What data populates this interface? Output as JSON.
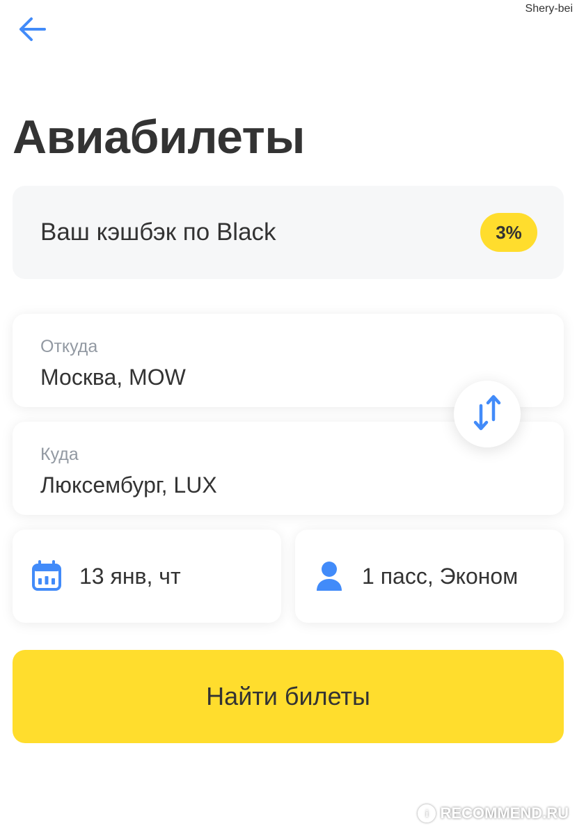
{
  "watermark_top": "Shery-bei",
  "header": {
    "back_icon": "arrow-left-icon",
    "title": "Авиабилеты"
  },
  "cashback": {
    "label": "Ваш кэшбэк по Black",
    "badge": "3%"
  },
  "from_field": {
    "label": "Откуда",
    "value": "Москва, MOW"
  },
  "to_field": {
    "label": "Куда",
    "value": "Люксембург, LUX"
  },
  "swap_icon": "swap-arrows-icon",
  "date_field": {
    "icon": "calendar-icon",
    "value": "13 янв, чт"
  },
  "passengers_field": {
    "icon": "person-icon",
    "value": "1 пасс, Эконом"
  },
  "search_button": {
    "label": "Найти билеты"
  },
  "watermark_bottom": {
    "logo_text": "i",
    "text": "RECOMMEND.RU"
  },
  "colors": {
    "accent_blue": "#428bf9",
    "brand_yellow": "#ffdd2d",
    "text_primary": "#333333",
    "text_secondary": "#9299a2",
    "card_bg": "#f6f7f8"
  }
}
